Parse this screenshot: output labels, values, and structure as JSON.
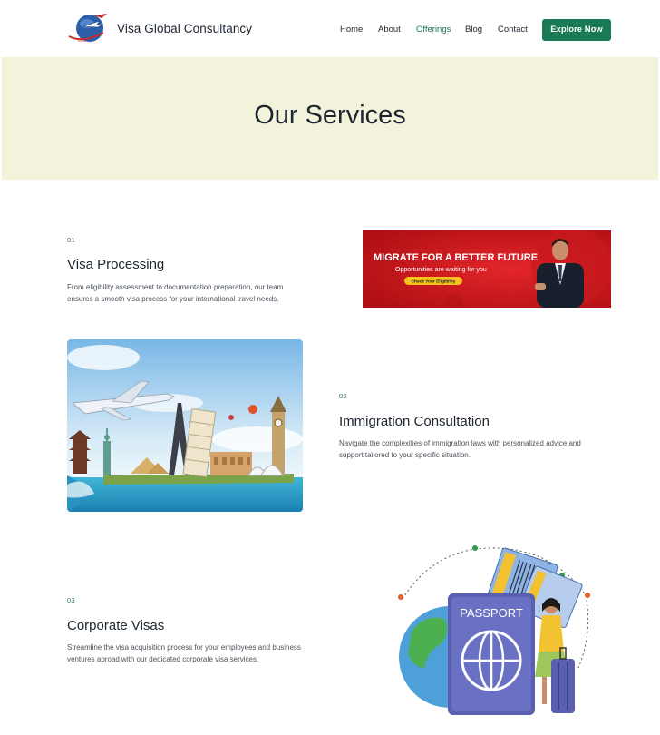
{
  "header": {
    "brand": "Visa Global Consultancy",
    "logo_tagline": "visa",
    "nav": [
      "Home",
      "About",
      "Offerings",
      "Blog",
      "Contact"
    ],
    "active_nav": "Offerings",
    "cta_label": "Explore Now"
  },
  "hero": {
    "title": "Our Services"
  },
  "services": [
    {
      "number": "01",
      "title": "Visa Processing",
      "description_lines": [
        "From eligibility assessment to documentation preparation, our team",
        "ensures a smooth visa process for your international travel needs."
      ]
    },
    {
      "number": "02",
      "title": "Immigration Consultation",
      "description_lines": [
        "Navigate the complexities of immigration laws with personalized advice and",
        "support tailored to your specific situation."
      ]
    },
    {
      "number": "03",
      "title": "Corporate Visas",
      "description_lines": [
        "Streamline the visa acquisition process for your employees and business",
        "ventures abroad with our dedicated corporate visa services."
      ]
    }
  ],
  "banner": {
    "headline": "MIGRATE FOR A BETTER FUTURE",
    "subline": "Opportunities are waiting for you",
    "button": "Check Your Eligibility"
  },
  "passport_art": {
    "label": "PASSPORT"
  },
  "colors": {
    "brand_green": "#197a55",
    "hero_bg": "#f3f3dc",
    "text_dark": "#1c2530",
    "banner_red": "#d3181c",
    "banner_yellow": "#f7c21b"
  }
}
